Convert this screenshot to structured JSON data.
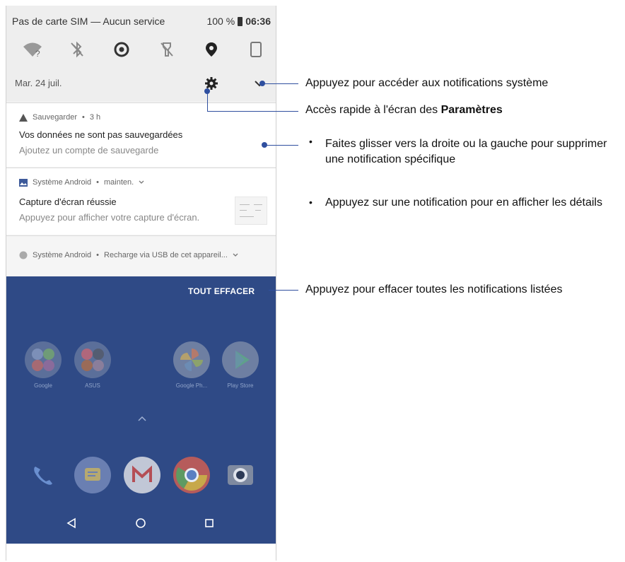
{
  "status_bar": {
    "carrier": "Pas de carte SIM — Aucun service",
    "battery": "100 %",
    "time": "06:36"
  },
  "quick_settings": {
    "tiles": [
      "wifi-off-icon",
      "bluetooth-off-icon",
      "data-saver-icon",
      "flashlight-off-icon",
      "location-icon",
      "auto-rotate-icon"
    ],
    "date": "Mar. 24 juil."
  },
  "notifications": [
    {
      "app": "Sauvegarder",
      "time": "3 h",
      "title": "Vos données ne sont pas sauvegardées",
      "text": "Ajoutez un compte de sauvegarde"
    },
    {
      "app": "Système Android",
      "time": "mainten.",
      "title": "Capture d'écran réussie",
      "text": "Appuyez pour afficher votre capture d'écran."
    },
    {
      "app": "Système Android",
      "summary": "Recharge via USB de cet appareil..."
    }
  ],
  "clear_all_label": "TOUT EFFACER",
  "home_apps": [
    {
      "label": "Google"
    },
    {
      "label": "ASUS"
    },
    {
      "label": "Google Ph..."
    },
    {
      "label": "Play Store"
    }
  ],
  "dock": [
    "phone-icon",
    "messages-icon",
    "gmail-icon",
    "chrome-icon",
    "camera-icon"
  ],
  "nav": [
    "back-icon",
    "home-icon",
    "recents-icon"
  ],
  "callouts": {
    "system_notifications": "Appuyez pour accéder aux notifications système",
    "settings_prefix": "Accès rapide à l'écran des",
    "settings_bold": "Paramètres",
    "swipe": "Faites glisser vers la droite ou la gauche pour supprimer une notification spécifique",
    "tap": "Appuyez sur une notification pour en afficher les détails",
    "bullet_char": "•",
    "clear": "Appuyez pour effacer toutes les notifications listées"
  },
  "colors": {
    "accent_line": "#2f4f9f",
    "home_background": "#2f4a86"
  }
}
